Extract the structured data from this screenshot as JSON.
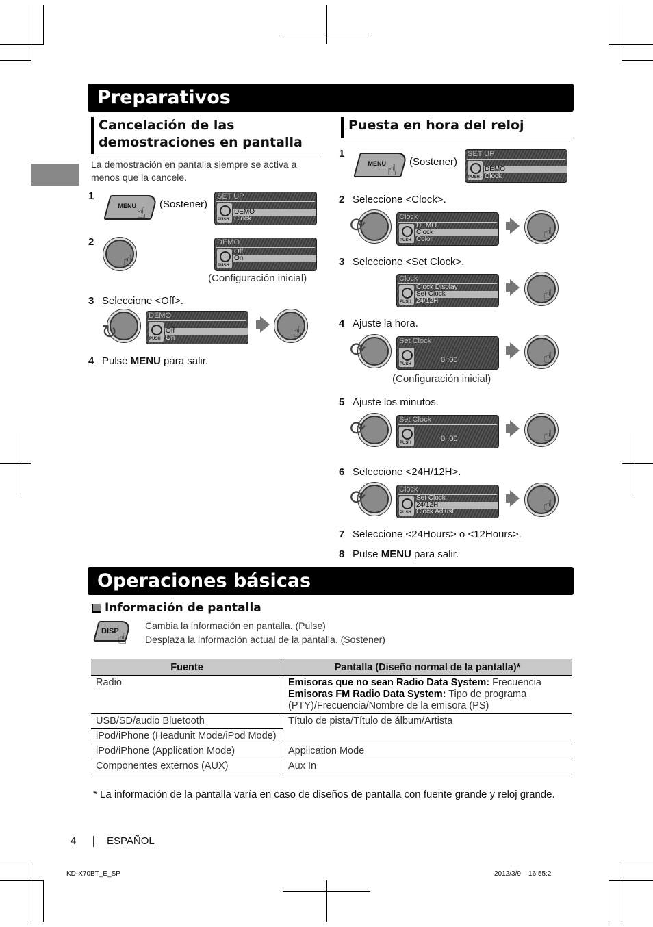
{
  "section1": {
    "title": "Preparativos",
    "left": {
      "heading_line1": "Cancelación de las",
      "heading_line2": "demostraciones en pantalla",
      "intro_line1": "La demostración en pantalla siempre se activa a",
      "intro_line2": "menos que la cancele.",
      "steps": [
        {
          "num": "1",
          "text": "(Sostener)",
          "button": "MENU",
          "lcd": {
            "title": "SET UP",
            "rows": [
              "",
              "DEMO",
              "Clock"
            ],
            "selected": 1
          }
        },
        {
          "num": "2",
          "caption": "(Configuración inicial)",
          "lcd": {
            "title": "DEMO",
            "rows": [
              "Off",
              "On",
              ""
            ],
            "selected": 1
          }
        },
        {
          "num": "3",
          "text": "Seleccione <Off>.",
          "lcd": {
            "title": "DEMO",
            "rows": [
              "",
              "Off",
              "On"
            ],
            "selected": 1
          }
        },
        {
          "num": "4",
          "text_pre": "Pulse ",
          "text_bold": "MENU",
          "text_post": " para salir."
        }
      ]
    },
    "right": {
      "heading": "Puesta en hora del reloj",
      "steps": [
        {
          "num": "1",
          "text": "(Sostener)",
          "button": "MENU",
          "lcd": {
            "title": "SET UP",
            "rows": [
              "",
              "DEMO",
              "Clock"
            ],
            "selected": 1
          }
        },
        {
          "num": "2",
          "text": "Seleccione <Clock>.",
          "lcd": {
            "title": "Clock",
            "rows": [
              "DEMO",
              "Clock",
              "Color"
            ],
            "selected": 1
          }
        },
        {
          "num": "3",
          "text": "Seleccione <Set Clock>.",
          "lcd": {
            "title": "Clock",
            "rows": [
              "Clock Display",
              "Set Clock",
              "24/12H"
            ],
            "selected": 1
          }
        },
        {
          "num": "4",
          "text": "Ajuste la hora.",
          "caption": "(Configuración inicial)",
          "lcd": {
            "title": "Set Clock",
            "time": "0 :00"
          }
        },
        {
          "num": "5",
          "text": "Ajuste los minutos.",
          "lcd": {
            "title": "Set Clock",
            "time": "0 :00"
          }
        },
        {
          "num": "6",
          "text": "Seleccione <24H/12H>.",
          "lcd": {
            "title": "Clock",
            "rows": [
              "Set Clock",
              "24/12H",
              "Clock Adjust"
            ],
            "selected": 1
          }
        },
        {
          "num": "7",
          "text": "Seleccione <24Hours> o <12Hours>."
        },
        {
          "num": "8",
          "text_pre": "Pulse ",
          "text_bold": "MENU",
          "text_post": " para salir."
        }
      ]
    }
  },
  "section2": {
    "title": "Operaciones básicas",
    "subheading": "Información de pantalla",
    "disp_button": "DISP",
    "disp_line1": "Cambia la información en pantalla. (Pulse)",
    "disp_line2": "Desplaza la información actual de la pantalla. (Sostener)",
    "table": {
      "headers": [
        "Fuente",
        "Pantalla (Diseño normal de la pantalla)*"
      ],
      "rows": [
        {
          "source": "Radio",
          "l1_bold": "Emisoras que no sean Radio Data System:",
          "l1": " Frecuencia",
          "l2_bold": "Emisoras FM Radio Data System:",
          "l2": " Tipo de programa",
          "l3": "(PTY)/Frecuencia/Nombre de la emisora (PS)"
        },
        {
          "source": "USB/SD/audio Bluetooth",
          "display": "Título de pista/Título de álbum/Artista"
        },
        {
          "source": "iPod/iPhone (Headunit Mode/iPod Mode)",
          "display": ""
        },
        {
          "source": "iPod/iPhone (Application Mode)",
          "display": "Application Mode"
        },
        {
          "source": "Componentes externos (AUX)",
          "display": "Aux In"
        }
      ]
    },
    "footnote": "*  La información de la pantalla varía en caso de diseños de pantalla con fuente grande y reloj grande."
  },
  "footer": {
    "page_number": "4",
    "language": "ESPAÑOL",
    "file_id": "KD-X70BT_E_SP",
    "timestamp": "2012/3/9    16:55:2"
  },
  "lcd_push_label": "PUSH"
}
